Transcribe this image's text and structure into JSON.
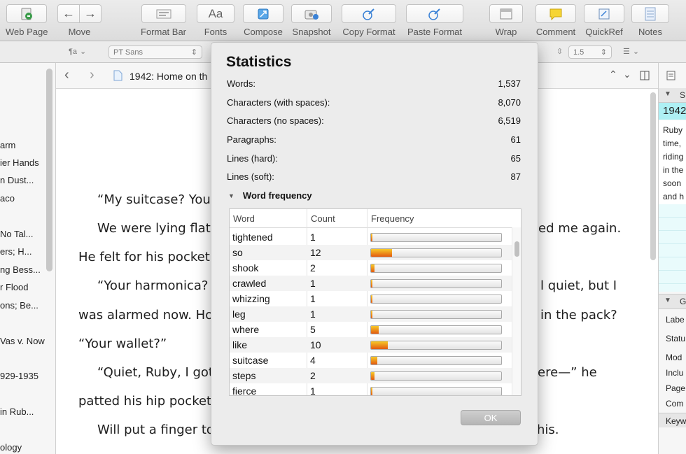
{
  "toolbar": {
    "items": [
      {
        "label": "Web Page",
        "icon": "web-page-icon"
      },
      {
        "label": "Move",
        "icon": "move-arrows-icon"
      },
      {
        "label": "Format Bar",
        "icon": "format-bar-icon"
      },
      {
        "label": "Fonts",
        "icon": "fonts-icon",
        "glyph": "Aa"
      },
      {
        "label": "Compose",
        "icon": "compose-icon"
      },
      {
        "label": "Snapshot",
        "icon": "snapshot-icon"
      },
      {
        "label": "Copy Format",
        "icon": "copy-format-icon"
      },
      {
        "label": "Paste Format",
        "icon": "paste-format-icon"
      },
      {
        "label": "Wrap",
        "icon": "wrap-icon"
      },
      {
        "label": "Comment",
        "icon": "comment-icon"
      },
      {
        "label": "QuickRef",
        "icon": "quickref-icon"
      },
      {
        "label": "Notes",
        "icon": "notes-icon"
      }
    ]
  },
  "format_bar": {
    "style_glyph": "¶a",
    "font": "PT Sans",
    "line_spacing": "1.5"
  },
  "binder": {
    "items": [
      "arm",
      "ier Hands",
      "n Dust...",
      "aco",
      "No Tal...",
      "ers; H...",
      "ng Bess...",
      "r Flood",
      "ons; Be...",
      "Vas v. Now",
      "929-1935",
      "in Rub...",
      "ology"
    ]
  },
  "editor": {
    "title": "1942: Home on th",
    "lines": [
      "“My suitcase? You",
      "We were lying flat",
      "ed me again.",
      "He felt for his pocket",
      "“Your harmonica?",
      "l quiet, but I",
      "was alarmed now. Ho",
      "in the pack?",
      "“Your wallet?”",
      "“Quiet, Ruby, I got",
      "ere—” he",
      "patted his hip pocket",
      "Will put a finger to",
      "his."
    ]
  },
  "inspector": {
    "synopsis_label": "S",
    "title_partial": "1942",
    "synopsis_lines": [
      "Ruby",
      "time,",
      "riding",
      "in the",
      "soon",
      "and h"
    ],
    "general_label": "G",
    "meta_labels": [
      "Labe",
      "Statu",
      "Mod",
      "Inclu",
      "Page",
      "Com",
      "Keyw"
    ]
  },
  "dialog": {
    "title": "Statistics",
    "stats": [
      {
        "label": "Words:",
        "value": "1,537"
      },
      {
        "label": "Characters (with spaces):",
        "value": "8,070"
      },
      {
        "label": "Characters (no spaces):",
        "value": "6,519"
      },
      {
        "label": "Paragraphs:",
        "value": "61"
      },
      {
        "label": "Lines (hard):",
        "value": "65"
      },
      {
        "label": "Lines (soft):",
        "value": "87"
      }
    ],
    "word_frequency_label": "Word frequency",
    "columns": [
      "Word",
      "Count",
      "Frequency"
    ],
    "rows": [
      {
        "word": "tightened",
        "count": "1",
        "freq": 0.01
      },
      {
        "word": "so",
        "count": "12",
        "freq": 0.16
      },
      {
        "word": "shook",
        "count": "2",
        "freq": 0.025
      },
      {
        "word": "crawled",
        "count": "1",
        "freq": 0.01
      },
      {
        "word": "whizzing",
        "count": "1",
        "freq": 0.01
      },
      {
        "word": "leg",
        "count": "1",
        "freq": 0.01
      },
      {
        "word": "where",
        "count": "5",
        "freq": 0.06
      },
      {
        "word": "like",
        "count": "10",
        "freq": 0.13
      },
      {
        "word": "suitcase",
        "count": "4",
        "freq": 0.05
      },
      {
        "word": "steps",
        "count": "2",
        "freq": 0.025
      },
      {
        "word": "fierce",
        "count": "1",
        "freq": 0.01
      }
    ],
    "ok_label": "OK"
  }
}
